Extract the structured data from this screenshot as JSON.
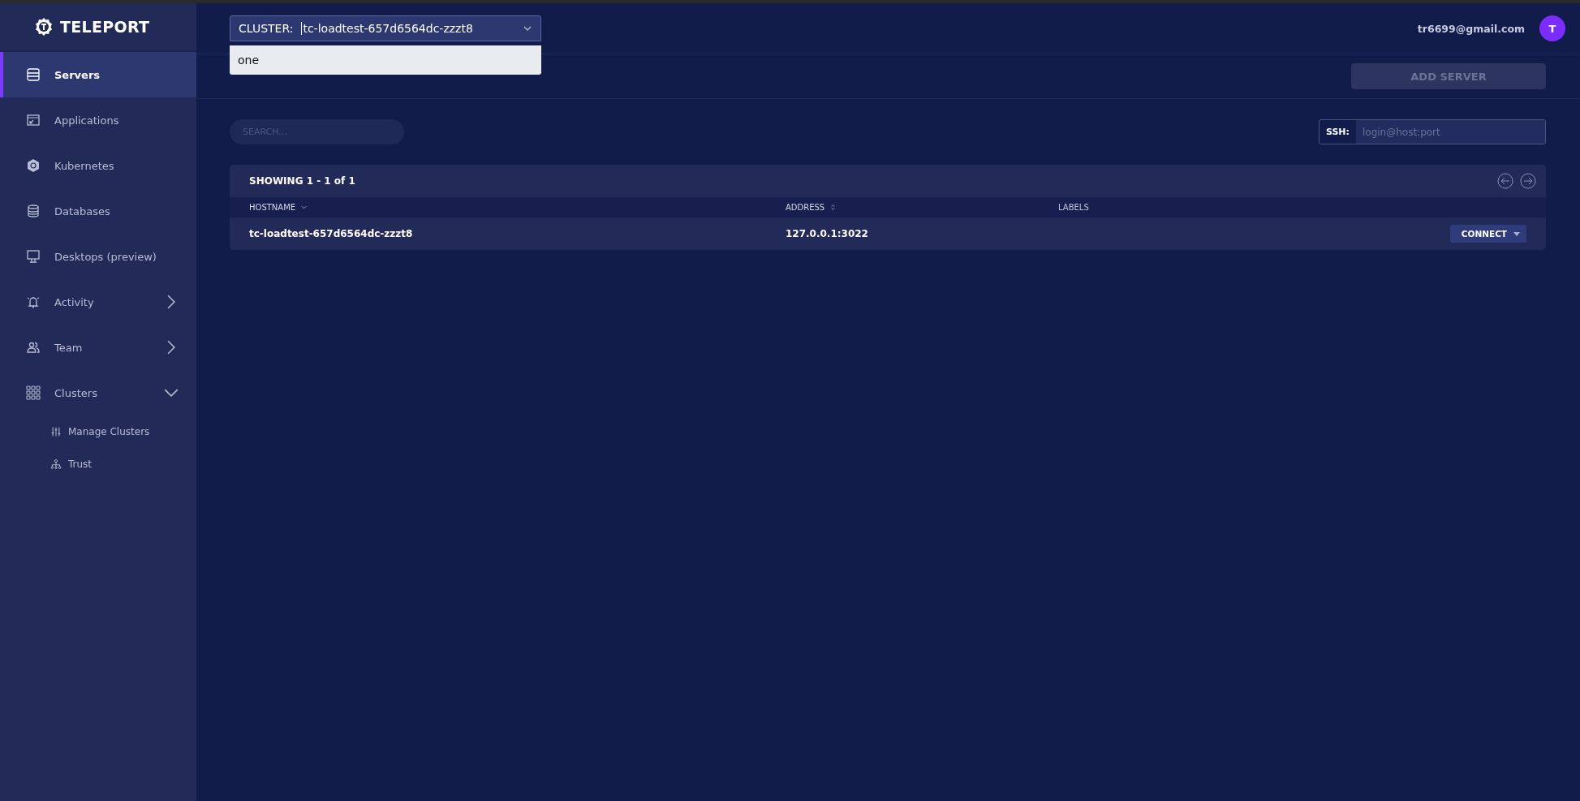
{
  "logo": {
    "text": "TELEPORT"
  },
  "sidebar": {
    "items": [
      {
        "label": "Servers",
        "selected": true
      },
      {
        "label": "Applications",
        "selected": false
      },
      {
        "label": "Kubernetes",
        "selected": false
      },
      {
        "label": "Databases",
        "selected": false
      },
      {
        "label": "Desktops (preview)",
        "selected": false
      },
      {
        "label": "Activity",
        "selected": false,
        "expanded": false
      },
      {
        "label": "Team",
        "selected": false,
        "expanded": false
      },
      {
        "label": "Clusters",
        "selected": false,
        "expanded": true,
        "children": [
          {
            "label": "Manage Clusters",
            "selected": false
          },
          {
            "label": "Trust",
            "selected": false
          }
        ]
      }
    ]
  },
  "cluster_select": {
    "label": "CLUSTER:",
    "value": "tc-loadtest-657d6564dc-zzzt8",
    "expanded": true,
    "options": [
      "one"
    ]
  },
  "user": {
    "email": "tr6699@gmail.com",
    "avatar": "T"
  },
  "add_button": {
    "label": "ADD SERVER",
    "disabled": true
  },
  "search": {
    "placeholder": "SEARCH..."
  },
  "ssh": {
    "label": "SSH:",
    "placeholder": "login@host:port"
  },
  "table": {
    "showing": "SHOWING 1 - 1 of 1",
    "columns": [
      {
        "label": "HOSTNAME",
        "sortable": true,
        "sorted": true
      },
      {
        "label": "ADDRESS",
        "sortable": true,
        "sorted": false
      },
      {
        "label": "LABELS",
        "sortable": false
      }
    ],
    "rows": [
      {
        "hostname": "tc-loadtest-657d6564dc-zzzt8",
        "address": "127.0.0.1:3022",
        "action": "CONNECT"
      }
    ]
  }
}
